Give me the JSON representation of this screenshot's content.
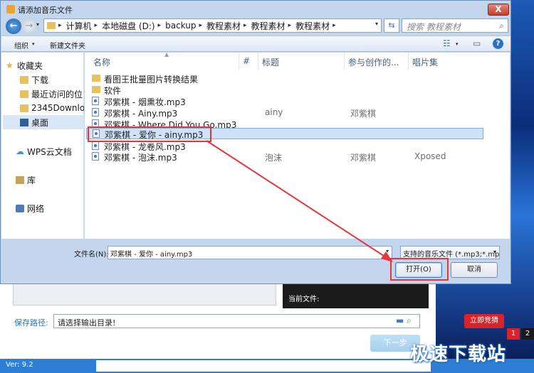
{
  "dialog": {
    "title": "请添加音乐文件",
    "close_label": "X"
  },
  "address": {
    "crumbs": [
      "计算机",
      "本地磁盘 (D:)",
      "backup",
      "教程素材",
      "教程素材",
      "教程素材"
    ],
    "search_placeholder": "搜索 教程素材"
  },
  "toolbar": {
    "organize": "组织",
    "new_folder": "新建文件夹"
  },
  "navpane": {
    "items": [
      {
        "label": "收藏夹",
        "icon": "star-icon"
      },
      {
        "label": "下载",
        "icon": "folder-icon"
      },
      {
        "label": "最近访问的位",
        "icon": "folder-icon"
      },
      {
        "label": "2345Downlo",
        "icon": "folder-icon"
      },
      {
        "label": "桌面",
        "icon": "desktop-icon"
      },
      {
        "label": "WPS云文档",
        "icon": "cloud-icon"
      },
      {
        "label": "库",
        "icon": "library-icon"
      },
      {
        "label": "网络",
        "icon": "network-icon"
      }
    ]
  },
  "columns": {
    "name": "名称",
    "num": "#",
    "title": "标题",
    "artist": "参与创作的...",
    "album": "唱片集"
  },
  "files": [
    {
      "name": "看图王批量图片转换结果",
      "type": "folder",
      "title": "",
      "artist": "",
      "album": ""
    },
    {
      "name": "软件",
      "type": "folder",
      "title": "",
      "artist": "",
      "album": ""
    },
    {
      "name": "邓紫棋 - 烟熏妆.mp3",
      "type": "file",
      "title": "",
      "artist": "",
      "album": ""
    },
    {
      "name": "邓紫棋 - Ainy.mp3",
      "type": "file",
      "title": "ainy",
      "artist": "邓紫棋",
      "album": ""
    },
    {
      "name": "邓紫棋 - Where Did You Go.mp3",
      "type": "file",
      "title": "",
      "artist": "",
      "album": ""
    },
    {
      "name": "邓紫棋 - 爱你 - ainy.mp3",
      "type": "file",
      "title": "",
      "artist": "",
      "album": ""
    },
    {
      "name": "邓紫棋 - 龙卷风.mp3",
      "type": "file",
      "title": "",
      "artist": "",
      "album": ""
    },
    {
      "name": "邓紫棋 - 泡沫.mp3",
      "type": "file",
      "title": "泡沫",
      "artist": "邓紫棋",
      "album": "Xposed"
    }
  ],
  "bottom": {
    "filename_label": "文件名(N):",
    "filename_value": "邓紫棋 - 爱你 - ainy.mp3",
    "filetype_value": "支持的音乐文件 (*.mp3;*.mp2",
    "open_label": "打开(O)",
    "cancel_label": "取消"
  },
  "background": {
    "current_file_label": "当前文件:",
    "save_path_label": "保存路径:",
    "save_path_placeholder": "请选择输出目录!",
    "next_label": "下一步",
    "version": "Ver: 9.2",
    "ad_button": "立即竞猜",
    "pages": [
      "1",
      "2"
    ],
    "watermark": "极速下载站"
  },
  "colors": {
    "accent": "#2d7fd6",
    "highlight_red": "#e8343a",
    "selection": "#cfe3f8"
  }
}
